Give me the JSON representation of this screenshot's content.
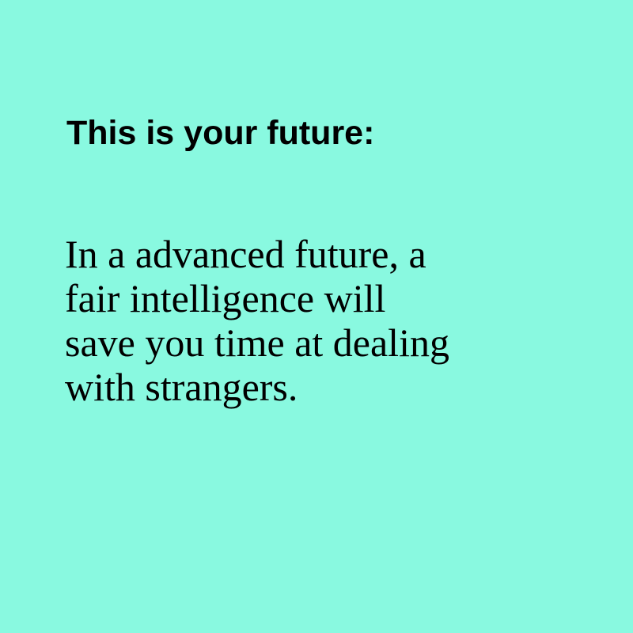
{
  "background_color": "#89f9e0",
  "text_color": "#000000",
  "heading": "This is your future:",
  "body_lines": [
    "In a advanced future, a",
    "fair intelligence will",
    "save you time at dealing",
    "with strangers."
  ]
}
